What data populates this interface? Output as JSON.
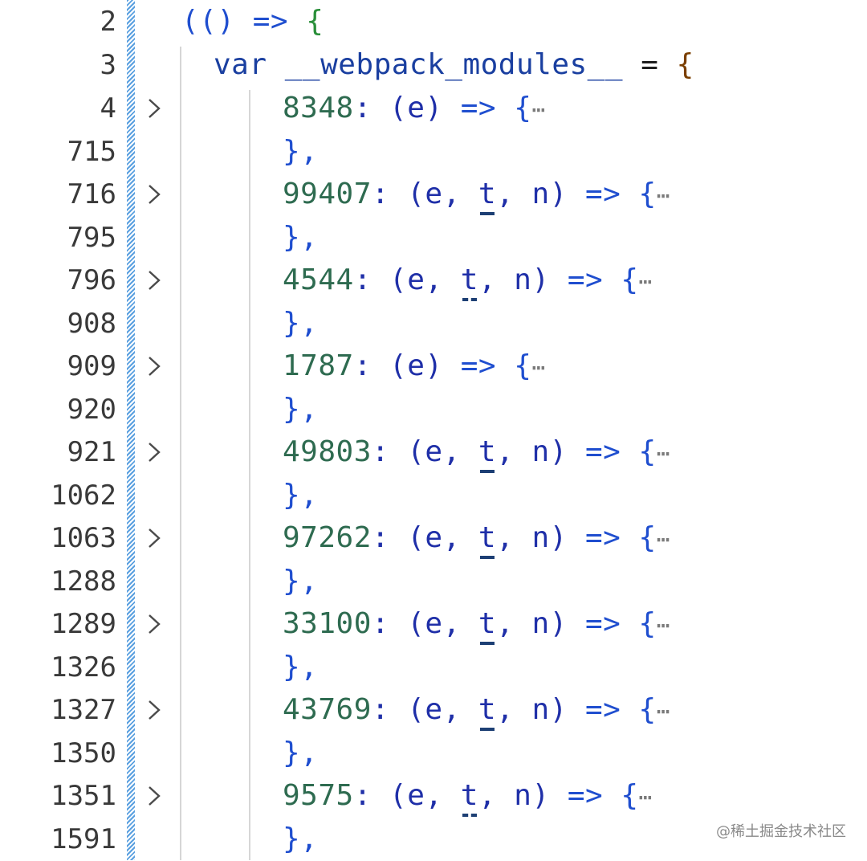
{
  "editor": {
    "header": {
      "line_number": "2",
      "text_open_paren": "(()",
      "text_arrow": " => ",
      "text_brace": "{"
    },
    "declaration": {
      "line_number": "3",
      "keyword": "var",
      "identifier": "__webpack_modules__",
      "operator": "=",
      "brace": "{"
    },
    "modules": [
      {
        "start_line": "4",
        "end_line": "715",
        "id": "8348",
        "params_prefix": ": (e)",
        "params_unused": "",
        "params_suffix": "",
        "arrow": " => {",
        "ellipsis": "⋯",
        "close": "},",
        "unused_style": ""
      },
      {
        "start_line": "716",
        "end_line": "795",
        "id": "99407",
        "params_prefix": ": (e, ",
        "params_unused": "t",
        "params_suffix": ", n)",
        "arrow": " => {",
        "ellipsis": "⋯",
        "close": "},",
        "unused_style": "solid"
      },
      {
        "start_line": "796",
        "end_line": "908",
        "id": "4544",
        "params_prefix": ": (e, ",
        "params_unused": "t",
        "params_suffix": ", n)",
        "arrow": " => {",
        "ellipsis": "⋯",
        "close": "},",
        "unused_style": "dotted"
      },
      {
        "start_line": "909",
        "end_line": "920",
        "id": "1787",
        "params_prefix": ": (e)",
        "params_unused": "",
        "params_suffix": "",
        "arrow": " => {",
        "ellipsis": "⋯",
        "close": "},",
        "unused_style": ""
      },
      {
        "start_line": "921",
        "end_line": "1062",
        "id": "49803",
        "params_prefix": ": (e, ",
        "params_unused": "t",
        "params_suffix": ", n)",
        "arrow": " => {",
        "ellipsis": "⋯",
        "close": "},",
        "unused_style": "solid"
      },
      {
        "start_line": "1063",
        "end_line": "1288",
        "id": "97262",
        "params_prefix": ": (e, ",
        "params_unused": "t",
        "params_suffix": ", n)",
        "arrow": " => {",
        "ellipsis": "⋯",
        "close": "},",
        "unused_style": "solid"
      },
      {
        "start_line": "1289",
        "end_line": "1326",
        "id": "33100",
        "params_prefix": ": (e, ",
        "params_unused": "t",
        "params_suffix": ", n)",
        "arrow": " => {",
        "ellipsis": "⋯",
        "close": "},",
        "unused_style": "solid"
      },
      {
        "start_line": "1327",
        "end_line": "1350",
        "id": "43769",
        "params_prefix": ": (e, ",
        "params_unused": "t",
        "params_suffix": ", n)",
        "arrow": " => {",
        "ellipsis": "⋯",
        "close": "},",
        "unused_style": "solid"
      },
      {
        "start_line": "1351",
        "end_line": "1591",
        "id": "9575",
        "params_prefix": ": (e, ",
        "params_unused": "t",
        "params_suffix": ", n)",
        "arrow": " => {",
        "ellipsis": "⋯",
        "close": "},",
        "unused_style": "dotted"
      }
    ]
  },
  "watermark": "@稀土掘金技术社区",
  "colors": {
    "number": "#2e6b50",
    "bracket_blue": "#1f4ecf",
    "bracket_green": "#2a8f3a",
    "brace_brown": "#7b3f00",
    "modified_gutter": "#5aa0e0"
  }
}
